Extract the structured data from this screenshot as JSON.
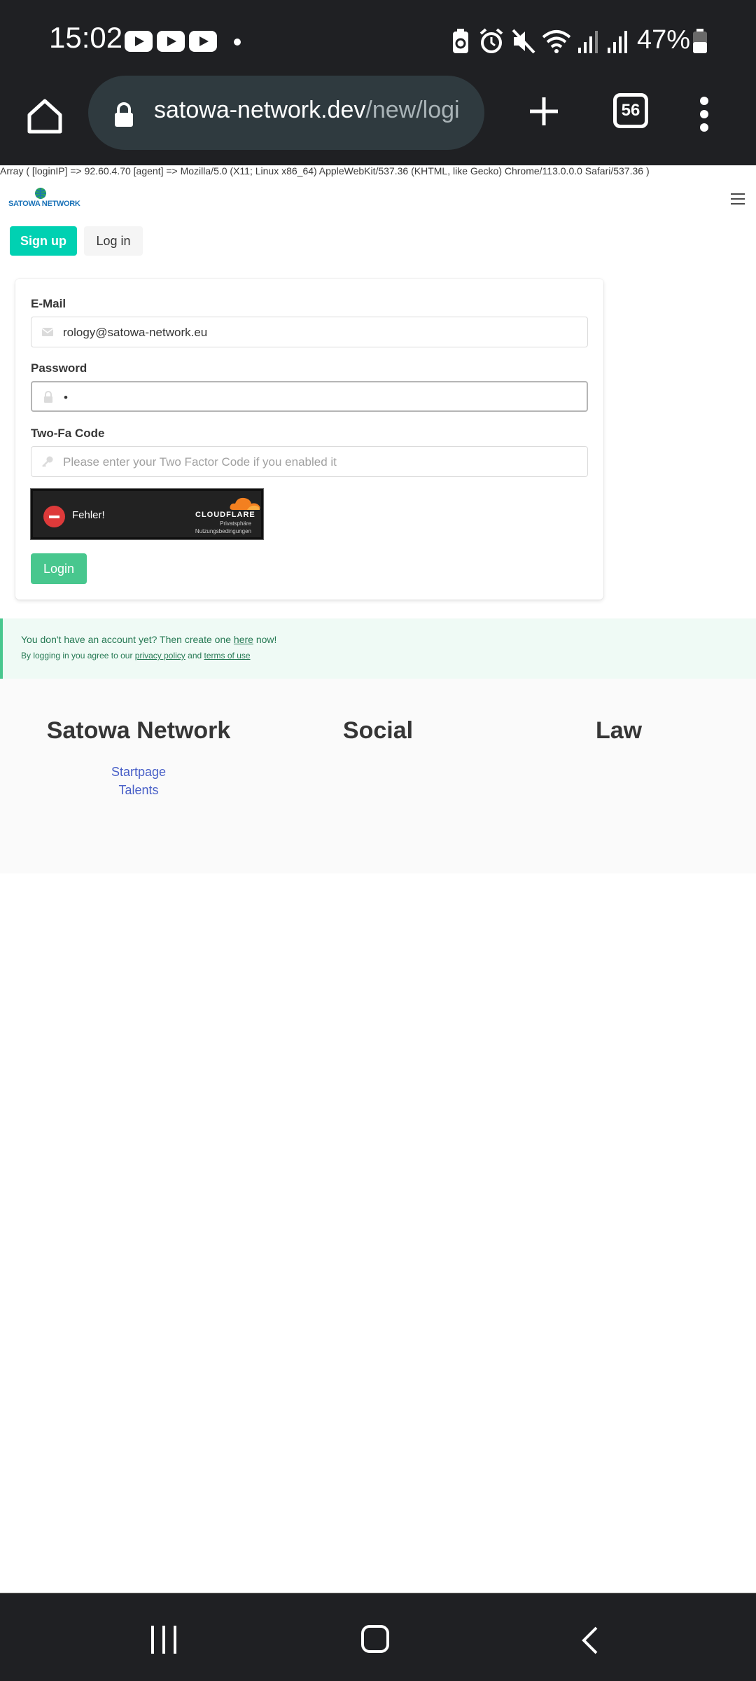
{
  "status_bar": {
    "time": "15:02",
    "battery_percent": "47%",
    "notification_icons": [
      "youtube-icon",
      "youtube-icon",
      "youtube-icon",
      "dot-icon"
    ],
    "system_icons": [
      "battery-saver-icon",
      "alarm-icon",
      "mute-icon",
      "wifi-icon",
      "signal-icon",
      "signal-icon",
      "battery-icon"
    ]
  },
  "browser": {
    "url_host": "satowa-network.dev",
    "url_path": "/new/logi",
    "tab_count": "56"
  },
  "page": {
    "debug_output": "Array ( [loginIP] => 92.60.4.70 [agent] => Mozilla/5.0 (X11; Linux x86_64) AppleWebKit/537.36 (KHTML, like Gecko) Chrome/113.0.0.0 Safari/537.36 )",
    "logo_text": "SATOWA NETWORK",
    "nav": {
      "signup_label": "Sign up",
      "login_label": "Log in"
    },
    "form": {
      "email_label": "E-Mail",
      "email_value": "rology@satowa-network.eu",
      "password_label": "Password",
      "password_value": "•",
      "twofa_label": "Two-Fa Code",
      "twofa_placeholder": "Please enter your Two Factor Code if you enabled it",
      "captcha": {
        "status": "Fehler!",
        "brand": "CLOUDFLARE",
        "privacy": "Privatsphäre",
        "terms": "Nutzungsbedingungen"
      },
      "submit_label": "Login"
    },
    "notice": {
      "line1_prefix": "You don't have an account yet? Then create one ",
      "line1_link": "here",
      "line1_suffix": " now!",
      "line2_prefix": "By logging in you agree to our ",
      "line2_link1": "privacy policy",
      "line2_mid": " and ",
      "line2_link2": "terms of use"
    },
    "footer": {
      "columns": [
        {
          "title": "Satowa Network",
          "links": [
            "Startpage",
            "Talents"
          ]
        },
        {
          "title": "Social",
          "links": []
        },
        {
          "title": "Law",
          "links": []
        }
      ]
    }
  },
  "colors": {
    "primary": "#00d1b2",
    "success": "#48c78e",
    "link": "#485fc7",
    "chrome_bg": "#1f2023"
  }
}
